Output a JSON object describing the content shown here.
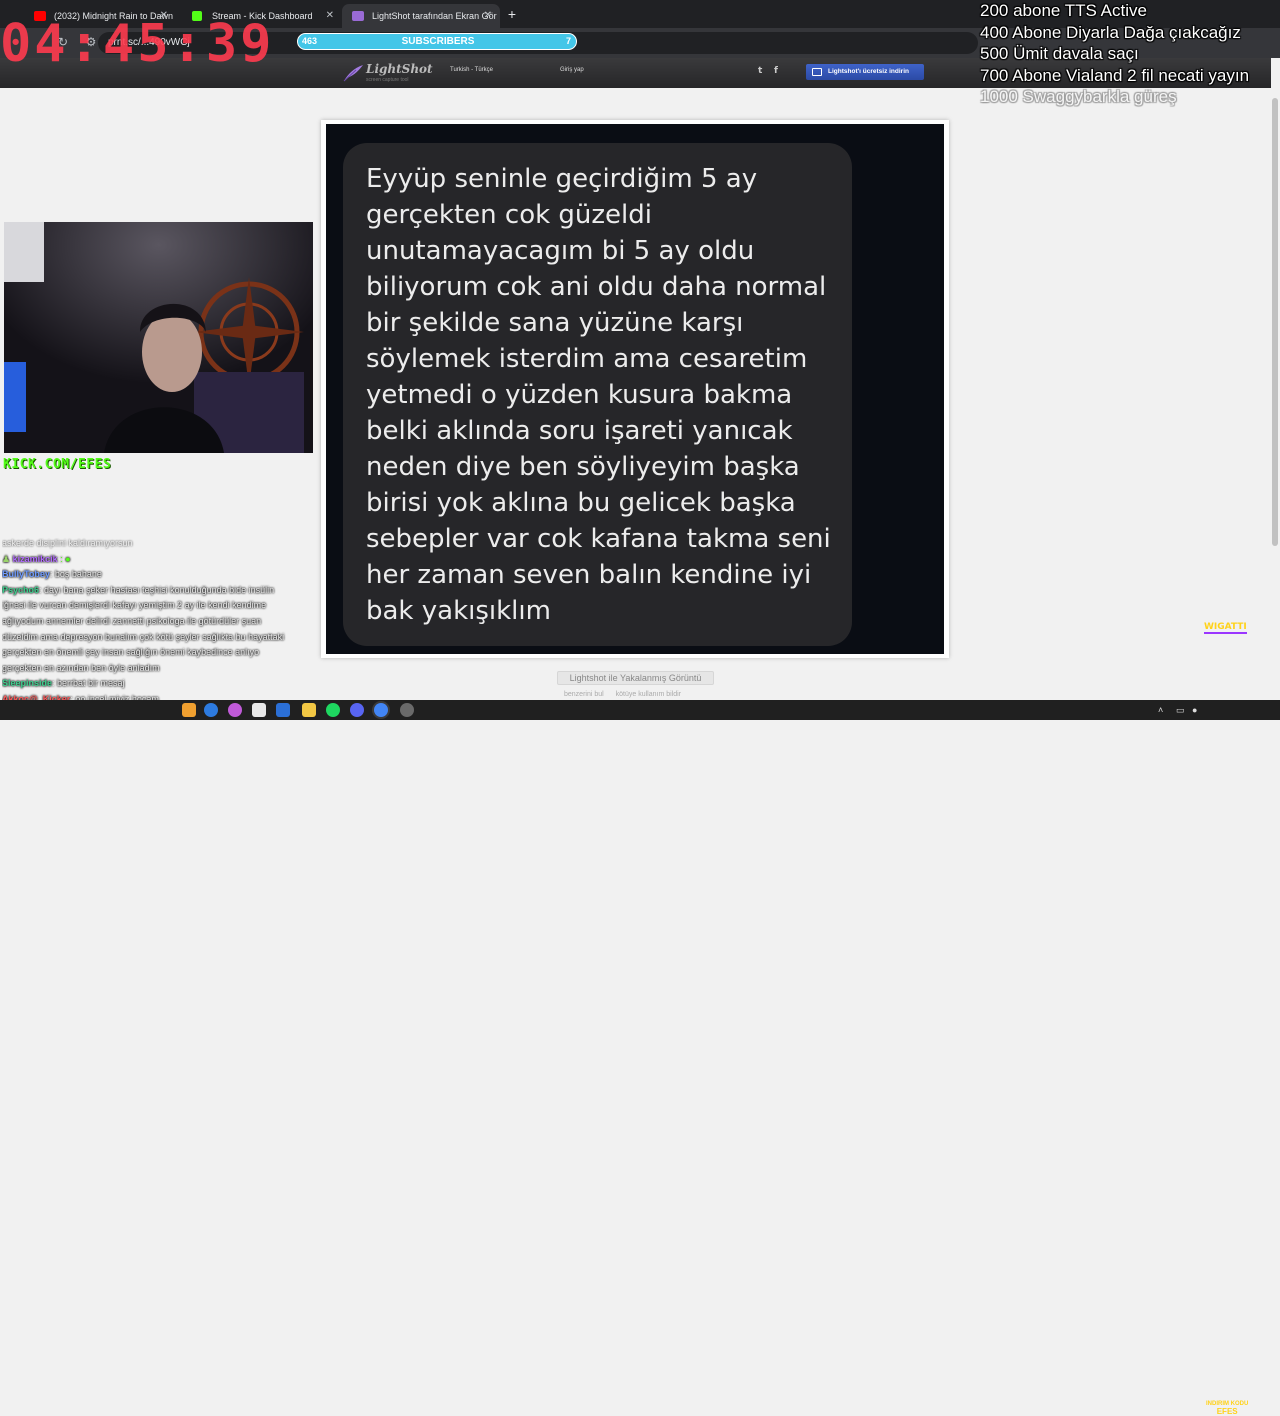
{
  "browser": {
    "tabs": [
      {
        "label": "(2032) Midnight Rain to Dawn",
        "icon": "youtube-icon",
        "color": "#ff0000"
      },
      {
        "label": "Stream - Kick Dashboard",
        "icon": "kick-icon",
        "color": "#53fc18"
      },
      {
        "label": "LightShot tarafından Ekran Gör",
        "icon": "lightshot-icon",
        "color": "#9a6bd6"
      }
    ],
    "new_tab": "+",
    "url": "prnt.sc/...490vWCj"
  },
  "lightshot": {
    "logo": "LightShot",
    "tagline": "screen capture tool",
    "language": "Turkish - Türkçe",
    "login": "Giriş yap",
    "twitter": "t",
    "facebook": "f",
    "download_button": "Lightshot'ı ücretsiz indirin",
    "caption": "Lightshot ile Yakalanmış Görüntü",
    "similar": "benzerini bul",
    "report": "kötüye kullanım bildir"
  },
  "screenshot": {
    "message": "Eyyüp seninle geçirdiğim 5 ay\ngerçekten cok güzeldi\nunutamayacagım bi 5 ay oldu\nbiliyorum cok ani oldu daha normal\nbir şekilde sana yüzüne karşı\nsöylemek isterdim ama cesaretim\nyetmedi o yüzden kusura bakma\nbelki aklında soru işareti yanıcak\nneden diye ben söyliyeyim başka\nbirisi yok aklına bu gelicek başka\nsebepler var cok kafana takma seni\nher zaman seven balın kendine iyi\nbak yakışıklım"
  },
  "overlay": {
    "timer": "04:45:39",
    "subs_current": "463",
    "subs_label": "SUBSCRIBERS",
    "subs_goal": "7",
    "goals": [
      "200 abone TTS Active",
      "400 Abone Diyarla Dağa çıakcağız",
      "500 Ümit davala saçı",
      "700 Abone Vialand 2 fil necati yayın",
      "1000 Swaggybarkla güreş"
    ],
    "kick_url": "KICK.COM/EFES",
    "wigatti": "WIGATTI"
  },
  "chat": [
    {
      "user": "",
      "text": "askerde disiplini kaldıramıyorsun",
      "color": "#e8e8e8"
    },
    {
      "user": "kizamikcik",
      "text": "",
      "color": "#b36bff"
    },
    {
      "user": "BullyTobey",
      "text": ": boş bahane",
      "color": "#6f9cff"
    },
    {
      "user": "Psycho6",
      "text": ": dayı bana şeker hastası teşhisi konulduğunda bide insülin",
      "color": "#3ecf8e"
    },
    {
      "user": "",
      "text": "iğnesi ile vurcan demişlerdi kafayı yemiştim 2 ay ile kendi kendime",
      "color": "#e8e8e8"
    },
    {
      "user": "",
      "text": "ağlıyodum annemler delirdi zannetti psikologa ile götürdüler şuan",
      "color": "#e8e8e8"
    },
    {
      "user": "",
      "text": "düzeldim ama depresyon bunalım çok kötü şeyler sağlıkta bu hayattaki",
      "color": "#e8e8e8"
    },
    {
      "user": "",
      "text": "gerçekten en önemli şey insan sağlığın önemi kaybedince anlıyo",
      "color": "#e8e8e8"
    },
    {
      "user": "",
      "text": "gerçekten en azından ben öyle anladım",
      "color": "#e8e8e8"
    },
    {
      "user": "Sleepinside",
      "text": ": berrbat bir mesaj",
      "color": "#3ecf8e"
    },
    {
      "user": "Akkoc@_Kicker",
      "text": ": oo incel miyiz hocam",
      "color": "#ff5a5a"
    }
  ],
  "taskbar": {
    "time": "INDIRIM KODU",
    "code": "EFES"
  }
}
